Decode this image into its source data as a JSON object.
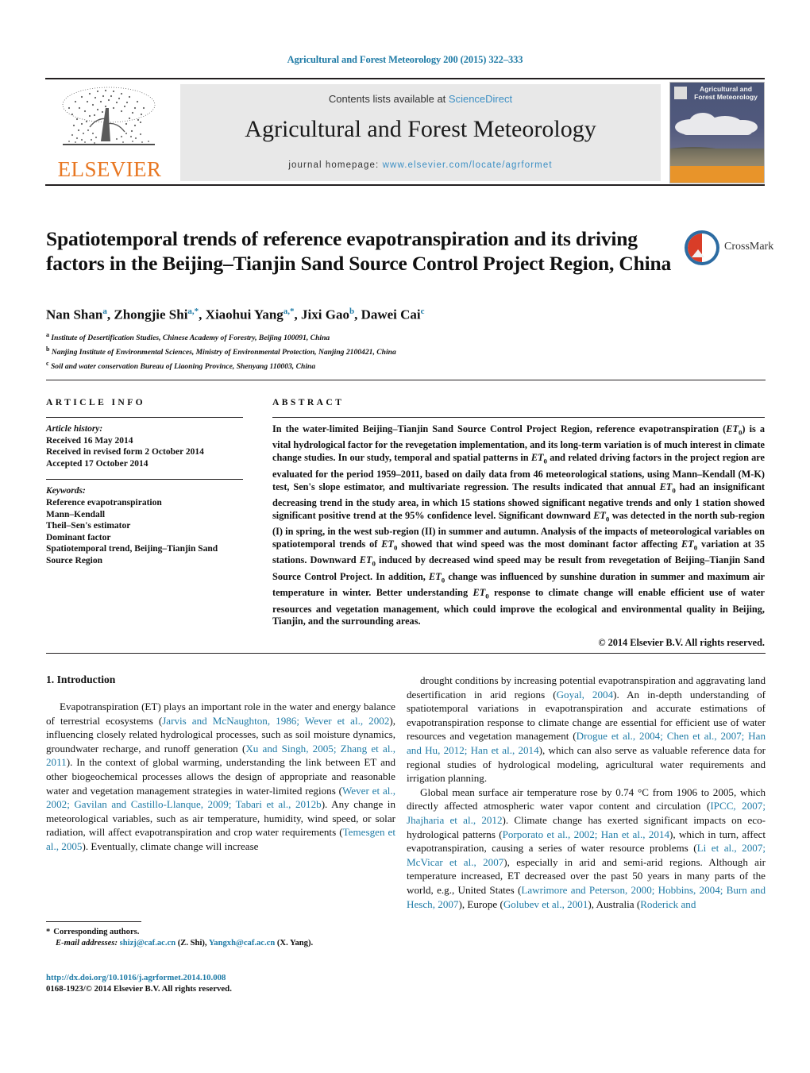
{
  "running_head": "Agricultural and Forest Meteorology 200 (2015) 322–333",
  "masthead": {
    "publisher_name": "ELSEVIER",
    "contents_prefix": "Contents lists available at ",
    "contents_link": "ScienceDirect",
    "journal_title": "Agricultural and Forest Meteorology",
    "homepage_prefix": "journal homepage: ",
    "homepage_url": "www.elsevier.com/locate/agrformet",
    "cover_title": "Agricultural and Forest Meteorology"
  },
  "article": {
    "title": "Spatiotemporal trends of reference evapotranspiration and its driving factors in the Beijing–Tianjin Sand Source Control Project Region, China",
    "crossmark_label": "CrossMark",
    "authors_html": "Nan Shan<sup>a</sup>, Zhongjie Shi<sup>a,*</sup>, Xiaohui Yang<sup>a,*</sup>, Jixi Gao<sup>b</sup>, Dawei Cai<sup>c</sup>",
    "affiliations": [
      {
        "marker": "a",
        "text": "Institute of Desertification Studies, Chinese Academy of Forestry, Beijing 100091, China"
      },
      {
        "marker": "b",
        "text": "Nanjing Institute of Environmental Sciences, Ministry of Environmental Protection, Nanjing 2100421, China"
      },
      {
        "marker": "c",
        "text": "Soil and water conservation Bureau of Liaoning Province, Shenyang 110003, China"
      }
    ]
  },
  "article_info": {
    "heading": "ARTICLE INFO",
    "history_label": "Article history:",
    "history": [
      "Received 16 May 2014",
      "Received in revised form 2 October 2014",
      "Accepted 17 October 2014"
    ],
    "keywords_label": "Keywords:",
    "keywords": [
      "Reference evapotranspiration",
      "Mann–Kendall",
      "Theil–Sen's estimator",
      "Dominant factor",
      "Spatiotemporal trend, Beijing–Tianjin Sand Source Region"
    ]
  },
  "abstract": {
    "heading": "ABSTRACT",
    "body_html": "In the water-limited Beijing–Tianjin Sand Source Control Project Region, reference evapotranspiration (<span class=\"et\">ET</span><sub>0</sub>) is a vital hydrological factor for the revegetation implementation, and its long-term variation is of much interest in climate change studies. In our study, temporal and spatial patterns in <span class=\"et\">ET</span><sub>0</sub> and related driving factors in the project region are evaluated for the period 1959–2011, based on daily data from 46 meteorological stations, using Mann–Kendall (M-K) test, Sen's slope estimator, and multivariate regression. The results indicated that annual <span class=\"et\">ET</span><sub>0</sub> had an insignificant decreasing trend in the study area, in which 15 stations showed significant negative trends and only 1 station showed significant positive trend at the 95% confidence level. Significant downward <span class=\"et\">ET</span><sub>0</sub> was detected in the north sub-region (I) in spring, in the west sub-region (II) in summer and autumn. Analysis of the impacts of meteorological variables on spatiotemporal trends of <span class=\"et\">ET</span><sub>0</sub> showed that wind speed was the most dominant factor affecting <span class=\"et\">ET</span><sub>0</sub> variation at 35 stations. Downward <span class=\"et\">ET</span><sub>0</sub> induced by decreased wind speed may be result from revegetation of Beijing–Tianjin Sand Source Control Project. In addition, <span class=\"et\">ET</span><sub>0</sub> change was influenced by sunshine duration in summer and maximum air temperature in winter. Better understanding <span class=\"et\">ET</span><sub>0</sub> response to climate change will enable efficient use of water resources and vegetation management, which could improve the ecological and environmental quality in Beijing, Tianjin, and the surrounding areas.",
    "copyright": "© 2014 Elsevier B.V. All rights reserved."
  },
  "introduction": {
    "heading": "1.  Introduction",
    "left_paragraphs_html": [
      "Evapotranspiration (ET) plays an important role in the water and energy balance of terrestrial ecosystems (<span class=\"ref\">Jarvis and McNaughton, 1986; Wever et al., 2002</span>), influencing closely related hydrological processes, such as soil moisture dynamics, groundwater recharge, and runoff generation (<span class=\"ref\">Xu and Singh, 2005; Zhang et al., 2011</span>). In the context of global warming, understanding the link between ET and other biogeochemical processes allows the design of appropriate and reasonable water and vegetation management strategies in water-limited regions (<span class=\"ref\">Wever et al., 2002; Gavilan and Castillo-Llanque, 2009; Tabari et al., 2012b</span>). Any change in meteorological variables, such as air temperature, humidity, wind speed, or solar radiation, will affect evapotranspiration and crop water requirements (<span class=\"ref\">Temesgen et al., 2005</span>). Eventually, climate change will increase"
    ],
    "right_paragraphs_html": [
      "drought conditions by increasing potential evapotranspiration and aggravating land desertification in arid regions (<span class=\"ref\">Goyal, 2004</span>). An in-depth understanding of spatiotemporal variations in evapotranspiration and accurate estimations of evapotranspiration response to climate change are essential for efficient use of water resources and vegetation management (<span class=\"ref\">Drogue et al., 2004; Chen et al., 2007; Han and Hu, 2012; Han et al., 2014</span>), which can also serve as valuable reference data for regional studies of hydrological modeling, agricultural water requirements and irrigation planning.",
      "Global mean surface air temperature rose by 0.74 °C from 1906 to 2005, which directly affected atmospheric water vapor content and circulation (<span class=\"ref\">IPCC, 2007; Jhajharia et al., 2012</span>). Climate change has exerted significant impacts on eco-hydrological patterns (<span class=\"ref\">Porporato et al., 2002; Han et al., 2014</span>), which in turn, affect evapotranspiration, causing a series of water resource problems (<span class=\"ref\">Li et al., 2007; McVicar et al., 2007</span>), especially in arid and semi-arid regions. Although air temperature increased, ET decreased over the past 50 years in many parts of the world, e.g., United States (<span class=\"ref\">Lawrimore and Peterson, 2000; Hobbins, 2004; Burn and Hesch, 2007</span>), Europe (<span class=\"ref\">Golubev et al., 2001</span>), Australia (<span class=\"ref\">Roderick and</span>"
    ]
  },
  "footnote": {
    "star": "*",
    "corresponding": "Corresponding authors.",
    "email_label": "E-mail addresses:",
    "emails": [
      {
        "address": "shizj@caf.ac.cn",
        "name": "(Z. Shi)"
      },
      {
        "address": "Yangxh@caf.ac.cn",
        "name": "(X. Yang)"
      }
    ]
  },
  "doi_block": {
    "doi": "http://dx.doi.org/10.1016/j.agrformet.2014.10.008",
    "issn_line": "0168-1923/© 2014 Elsevier B.V. All rights reserved."
  },
  "colors": {
    "link_blue": "#1f7ba6",
    "sciencedirect_blue": "#3c8fc4",
    "elsevier_orange": "#E87722",
    "panel_grey": "#e8e8e8"
  }
}
